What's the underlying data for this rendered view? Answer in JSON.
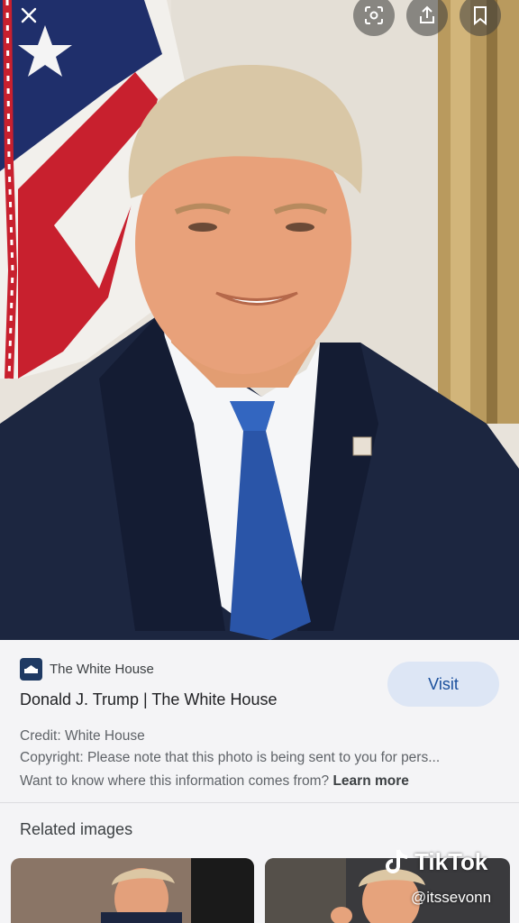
{
  "source": {
    "name": "The White House",
    "title": "Donald J. Trump | The White House",
    "visit_label": "Visit"
  },
  "details": {
    "credit": "Credit: White House",
    "copyright": "Copyright: Please note that this photo is being sent to you for pers...",
    "info_question": "Want to know where this information comes from?",
    "learn_more": "Learn more"
  },
  "related": {
    "heading": "Related images"
  },
  "icons": {
    "close": "close-icon",
    "lens": "lens-icon",
    "share": "share-icon",
    "save": "bookmark-icon"
  },
  "overlay": {
    "brand": "TikTok",
    "handle": "@itssevonn"
  }
}
